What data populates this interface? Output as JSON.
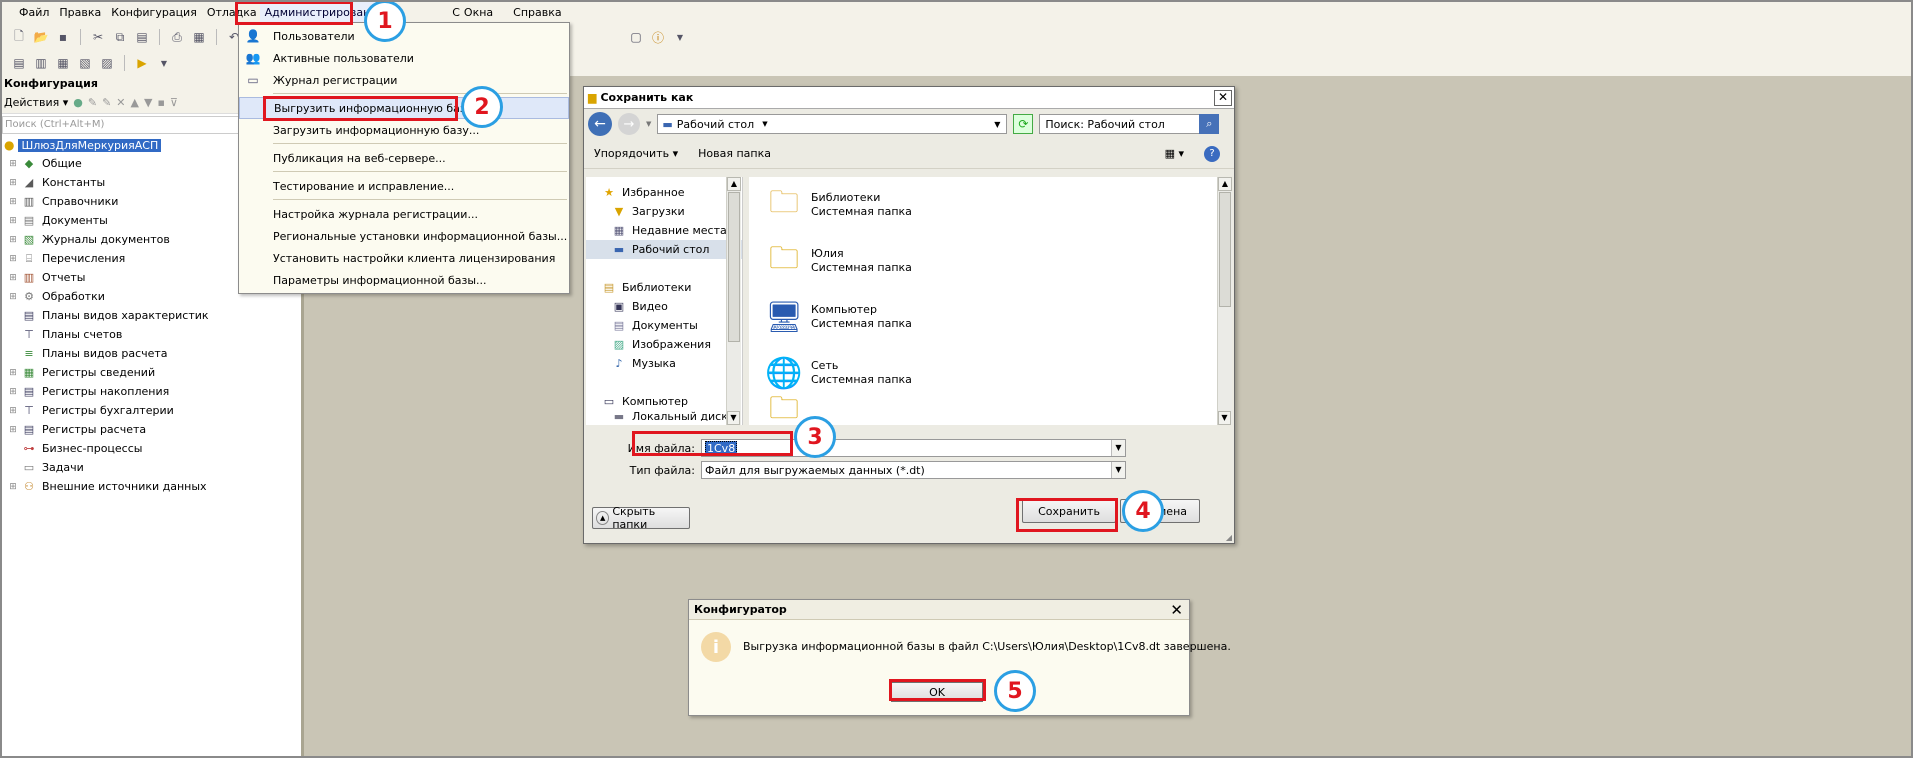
{
  "menubar": {
    "items": [
      "Файл",
      "Правка",
      "Конфигурация",
      "Отладка",
      "Администрирование",
      "С",
      "Окна",
      "Справка"
    ]
  },
  "config_panel": {
    "title": "Конфигурация",
    "actions_label": "Действия",
    "search_placeholder": "Поиск (Ctrl+Alt+M)",
    "root": "ШлюзДляМеркурияАСП",
    "items": [
      "Общие",
      "Константы",
      "Справочники",
      "Документы",
      "Журналы документов",
      "Перечисления",
      "Отчеты",
      "Обработки",
      "Планы видов характеристик",
      "Планы счетов",
      "Планы видов расчета",
      "Регистры сведений",
      "Регистры накопления",
      "Регистры бухгалтерии",
      "Регистры расчета",
      "Бизнес-процессы",
      "Задачи",
      "Внешние источники данных"
    ]
  },
  "admin_menu": {
    "items": [
      "Пользователи",
      "Активные пользователи",
      "Журнал регистрации",
      "Выгрузить информационную базу...",
      "Загрузить информационную базу...",
      "Публикация на веб-сервере...",
      "Тестирование и исправление...",
      "Настройка журнала регистрации...",
      "Региональные установки информационной базы...",
      "Установить настройки клиента лицензирования",
      "Параметры информационной базы..."
    ]
  },
  "save_dialog": {
    "title": "Сохранить как",
    "location": "Рабочий стол",
    "search_placeholder": "Поиск: Рабочий стол",
    "organize_label": "Упорядочить",
    "new_folder_label": "Новая папка",
    "nav": {
      "favorites": "Избранное",
      "downloads": "Загрузки",
      "recent": "Недавние места",
      "desktop": "Рабочий стол",
      "libraries": "Библиотеки",
      "video": "Видео",
      "documents": "Документы",
      "images": "Изображения",
      "music": "Музыка",
      "computer": "Компьютер",
      "local_disk": "Локальный диск ("
    },
    "files": [
      {
        "name": "Библиотеки",
        "type": "Системная папка"
      },
      {
        "name": "Юлия",
        "type": "Системная папка"
      },
      {
        "name": "Компьютер",
        "type": "Системная папка"
      },
      {
        "name": "Сеть",
        "type": "Системная папка"
      }
    ],
    "file_name_label": "Имя файла:",
    "file_name_value": "1Cv8",
    "file_type_label": "Тип файла:",
    "file_type_value": "Файл для выгружаемых данных (*.dt)",
    "hide_folders_label": "Скрыть папки",
    "save_label": "Сохранить",
    "cancel_label": "мена"
  },
  "info_dialog": {
    "title": "Конфигуратор",
    "message": "Выгрузка информационной базы в файл C:\\Users\\Юлия\\Desktop\\1Cv8.dt завершена.",
    "ok_label": "OK"
  },
  "annotations": [
    "1",
    "2",
    "3",
    "4",
    "5"
  ],
  "colors": {
    "annotation_red": "#e0161f",
    "annotation_blue": "#2b9fe3",
    "workspace": "#c9c5b5",
    "selection": "#316ac5"
  }
}
